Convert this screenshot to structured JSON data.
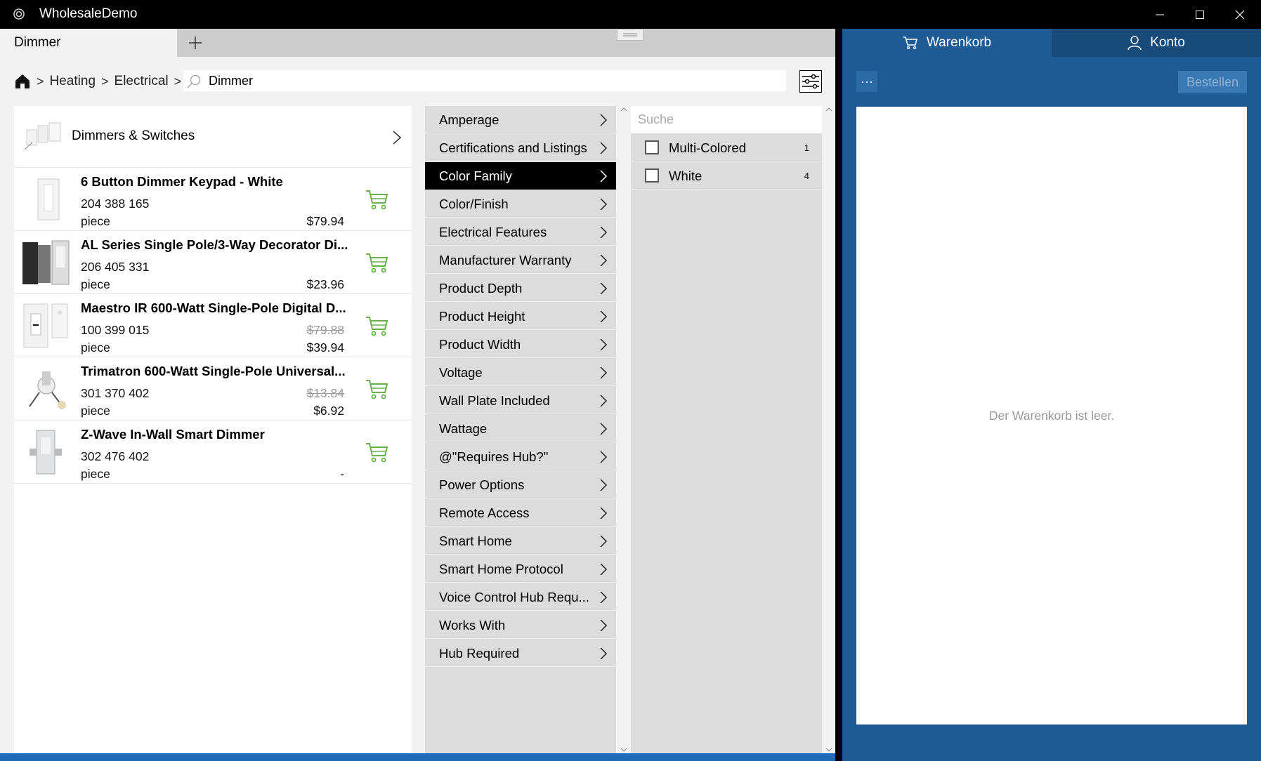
{
  "window": {
    "title": "WholesaleDemo",
    "controls": [
      "minimize",
      "maximize",
      "close"
    ]
  },
  "tabs": [
    {
      "label": "Dimmer",
      "active": true
    }
  ],
  "breadcrumb": {
    "items": [
      "Heating",
      "Electrical"
    ],
    "separator": ">"
  },
  "search": {
    "value": "Dimmer"
  },
  "category": {
    "label": "Dimmers & Switches"
  },
  "products": [
    {
      "name": "6 Button Dimmer Keypad - White",
      "sku": "204 388 165",
      "unit": "piece",
      "old_price": "",
      "price": "$79.94"
    },
    {
      "name": "AL Series Single Pole/3-Way Decorator Di...",
      "sku": "206 405 331",
      "unit": "piece",
      "old_price": "",
      "price": "$23.96"
    },
    {
      "name": "Maestro IR 600-Watt Single-Pole Digital D...",
      "sku": "100 399 015",
      "unit": "piece",
      "old_price": "$79.88",
      "price": "$39.94"
    },
    {
      "name": "Trimatron 600-Watt Single-Pole Universal...",
      "sku": "301 370 402",
      "unit": "piece",
      "old_price": "$13.84",
      "price": "$6.92"
    },
    {
      "name": "Z-Wave In-Wall Smart Dimmer",
      "sku": "302 476 402",
      "unit": "piece",
      "old_price": "",
      "price": "-"
    }
  ],
  "attributes": [
    {
      "label": "Amperage",
      "active": false
    },
    {
      "label": "Certifications and Listings",
      "active": false
    },
    {
      "label": "Color Family",
      "active": true
    },
    {
      "label": "Color/Finish",
      "active": false
    },
    {
      "label": "Electrical Features",
      "active": false
    },
    {
      "label": "Manufacturer Warranty",
      "active": false
    },
    {
      "label": "Product Depth",
      "active": false
    },
    {
      "label": "Product Height",
      "active": false
    },
    {
      "label": "Product Width",
      "active": false
    },
    {
      "label": "Voltage",
      "active": false
    },
    {
      "label": "Wall Plate Included",
      "active": false
    },
    {
      "label": "Wattage",
      "active": false
    },
    {
      "label": "@\"Requires Hub?\"",
      "active": false
    },
    {
      "label": "Power Options",
      "active": false
    },
    {
      "label": "Remote Access",
      "active": false
    },
    {
      "label": "Smart Home",
      "active": false
    },
    {
      "label": "Smart Home Protocol",
      "active": false
    },
    {
      "label": "Voice Control Hub Requ...",
      "active": false
    },
    {
      "label": "Works With",
      "active": false
    },
    {
      "label": "Hub Required",
      "active": false
    }
  ],
  "values": {
    "search_placeholder": "Suche",
    "items": [
      {
        "label": "Multi-Colored",
        "count": "1",
        "checked": false
      },
      {
        "label": "White",
        "count": "4",
        "checked": false
      }
    ]
  },
  "cart": {
    "tab_cart": "Warenkorb",
    "tab_account": "Konto",
    "more_label": "···",
    "order_label": "Bestellen",
    "empty_message": "Der Warenkorb ist leer."
  },
  "colors": {
    "accent_blue": "#1e5a94",
    "cart_icon_green": "#6ab04c",
    "active_item": "#000000"
  }
}
